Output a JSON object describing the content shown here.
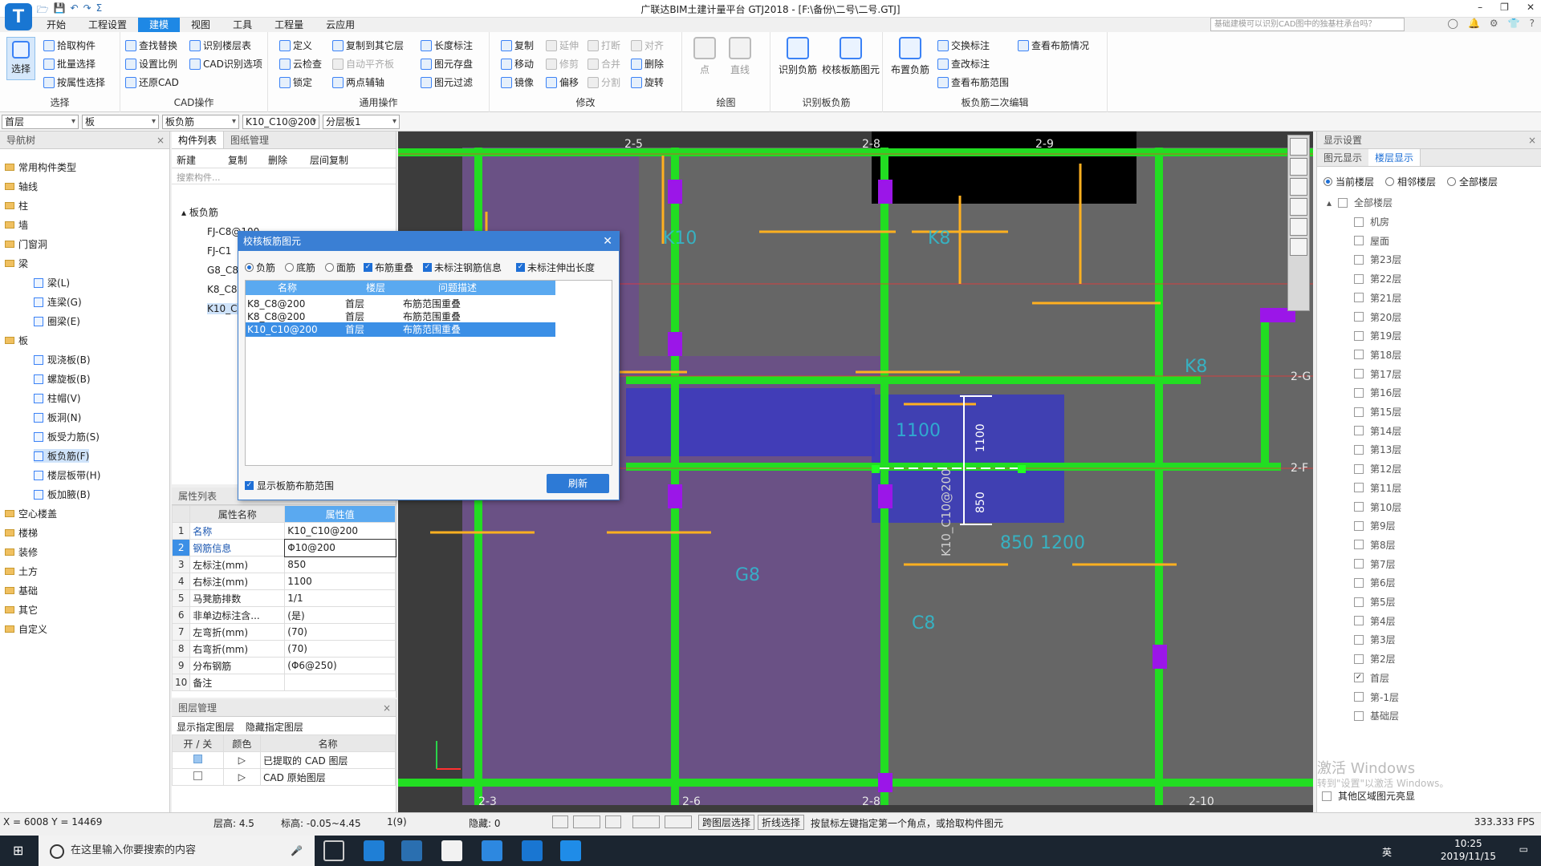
{
  "titlebar": {
    "title": "广联达BIM土建计量平台 GTJ2018 - [F:\\备份\\二号\\二号.GTJ]",
    "controls": [
      "–",
      "❐",
      "✕"
    ]
  },
  "menu": {
    "tabs": [
      "开始",
      "工程设置",
      "建模",
      "视图",
      "工具",
      "工程量",
      "云应用"
    ],
    "active": "建模",
    "search_placeholder": "基础建模可以识别CAD图中的独基柱承台吗？"
  },
  "ribbon": {
    "select": {
      "big": "选择",
      "items": [
        "拾取构件",
        "批量选择",
        "按属性选择"
      ],
      "label": "选择"
    },
    "cad": {
      "items": [
        "查找替换",
        "识别楼层表",
        "设置比例",
        "CAD识别选项",
        "还原CAD"
      ],
      "label": "CAD操作"
    },
    "general": {
      "items": [
        "定义",
        "复制到其它层",
        "长度标注",
        "云检查",
        "自动平齐板",
        "图元存盘",
        "锁定",
        "两点辅轴",
        "图元过滤"
      ],
      "label": "通用操作"
    },
    "modify": {
      "items": [
        "复制",
        "延伸",
        "打断",
        "对齐",
        "删除",
        "移动",
        "修剪",
        "合并",
        "镜像",
        "偏移",
        "分割",
        "旋转"
      ],
      "label": "修改"
    },
    "draw": {
      "items": [
        "点",
        "直线"
      ],
      "label": "绘图"
    },
    "recog": {
      "items": [
        "识别负筋",
        "校核板筋图元"
      ],
      "label": "识别板负筋"
    },
    "edit2": {
      "items": [
        "布置负筋",
        "交换标注",
        "查看布筋情况",
        "查改标注",
        "查看布筋范围"
      ],
      "label": "板负筋二次编辑"
    }
  },
  "filters": [
    "首层",
    "板",
    "板负筋",
    "K10_C10@200",
    "分层板1"
  ],
  "navtree": {
    "title": "导航树",
    "items": [
      {
        "label": "常用构件类型",
        "type": "folder"
      },
      {
        "label": "轴线",
        "type": "folder"
      },
      {
        "label": "柱",
        "type": "folder"
      },
      {
        "label": "墙",
        "type": "folder"
      },
      {
        "label": "门窗洞",
        "type": "folder"
      },
      {
        "label": "梁",
        "type": "folder"
      },
      {
        "label": "梁(L)",
        "type": "sub"
      },
      {
        "label": "连梁(G)",
        "type": "sub"
      },
      {
        "label": "圈梁(E)",
        "type": "sub"
      },
      {
        "label": "板",
        "type": "folder"
      },
      {
        "label": "现浇板(B)",
        "type": "sub"
      },
      {
        "label": "螺旋板(B)",
        "type": "sub"
      },
      {
        "label": "柱帽(V)",
        "type": "sub"
      },
      {
        "label": "板洞(N)",
        "type": "sub"
      },
      {
        "label": "板受力筋(S)",
        "type": "sub"
      },
      {
        "label": "板负筋(F)",
        "type": "sub",
        "selected": true
      },
      {
        "label": "楼层板带(H)",
        "type": "sub"
      },
      {
        "label": "板加腋(B)",
        "type": "sub"
      },
      {
        "label": "空心楼盖",
        "type": "folder"
      },
      {
        "label": "楼梯",
        "type": "folder"
      },
      {
        "label": "装修",
        "type": "folder"
      },
      {
        "label": "土方",
        "type": "folder"
      },
      {
        "label": "基础",
        "type": "folder"
      },
      {
        "label": "其它",
        "type": "folder"
      },
      {
        "label": "自定义",
        "type": "folder"
      }
    ]
  },
  "complist": {
    "tabs": [
      "构件列表",
      "图纸管理"
    ],
    "toolbar": [
      "新建",
      "复制",
      "删除",
      "层间复制"
    ],
    "search_placeholder": "搜索构件...",
    "root": "板负筋",
    "items": [
      "FJ-C8@100",
      "FJ-C1",
      "G8_C8",
      "K8_C8",
      "K10_C"
    ]
  },
  "props": {
    "title": "属性列表",
    "col_name": "属性名称",
    "col_value": "属性值",
    "rows": [
      {
        "n": "1",
        "k": "名称",
        "v": "K10_C10@200",
        "blue": true
      },
      {
        "n": "2",
        "k": "钢筋信息",
        "v": "Φ10@200",
        "blue": true
      },
      {
        "n": "3",
        "k": "左标注(mm)",
        "v": "850"
      },
      {
        "n": "4",
        "k": "右标注(mm)",
        "v": "1100"
      },
      {
        "n": "5",
        "k": "马凳筋排数",
        "v": "1/1"
      },
      {
        "n": "6",
        "k": "非单边标注含...",
        "v": "(是)"
      },
      {
        "n": "7",
        "k": "左弯折(mm)",
        "v": "(70)"
      },
      {
        "n": "8",
        "k": "右弯折(mm)",
        "v": "(70)"
      },
      {
        "n": "9",
        "k": "分布钢筋",
        "v": "(Φ6@250)"
      },
      {
        "n": "10",
        "k": "备注",
        "v": ""
      }
    ]
  },
  "layers": {
    "title": "图层管理",
    "links": [
      "显示指定图层",
      "隐藏指定图层"
    ],
    "cols": [
      "开 / 关",
      "颜色",
      "名称"
    ],
    "rows": [
      {
        "name": "已提取的 CAD 图层",
        "on": true
      },
      {
        "name": "CAD 原始图层",
        "on": false
      }
    ]
  },
  "dialog": {
    "title": "校核板筋图元",
    "options": [
      "负筋",
      "底筋",
      "面筋",
      "布筋重叠",
      "未标注钢筋信息",
      "未标注伸出长度"
    ],
    "cols": [
      "名称",
      "楼层",
      "问题描述"
    ],
    "rows": [
      {
        "name": "K8_C8@200",
        "floor": "首层",
        "desc": "布筋范围重叠"
      },
      {
        "name": "K8_C8@200",
        "floor": "首层",
        "desc": "布筋范围重叠"
      },
      {
        "name": "K10_C10@200",
        "floor": "首层",
        "desc": "布筋范围重叠",
        "selected": true
      }
    ],
    "show_range": "显示板筋布筋范围",
    "refresh": "刷新"
  },
  "canvas": {
    "axes": [
      "2-5",
      "2-8",
      "2-9",
      "2-3",
      "2-6",
      "2-8",
      "2-10",
      "2-G",
      "2-F"
    ],
    "rebar_label": "K10_C10@200",
    "dim1": "1100",
    "dim2": "850",
    "labels": [
      "K10",
      "K8",
      "K8",
      "850",
      "1100",
      "850",
      "1200",
      "G8",
      "C8"
    ]
  },
  "display": {
    "title": "显示设置",
    "tabs": [
      "图元显示",
      "楼层显示"
    ],
    "radios": [
      "当前楼层",
      "相邻楼层",
      "全部楼层"
    ],
    "all": "全部楼层",
    "floors": [
      "机房",
      "屋面",
      "第23层",
      "第22层",
      "第21层",
      "第20层",
      "第19层",
      "第18层",
      "第17层",
      "第16层",
      "第15层",
      "第14层",
      "第13层",
      "第12层",
      "第11层",
      "第10层",
      "第9层",
      "第8层",
      "第7层",
      "第6层",
      "第5层",
      "第4层",
      "第3层",
      "第2层",
      "首层",
      "第-1层",
      "基础层"
    ],
    "checked_floor": "首层",
    "other_region": "其他区域图元亮显",
    "watermark1": "激活 Windows",
    "watermark2": "转到\"设置\"以激活 Windows。"
  },
  "status": {
    "coords": "X = 6008 Y = 14469",
    "floor_h": "层高:  4.5",
    "elev": "标高:  -0.05~4.45",
    "count": "1(9)",
    "hidden": "隐藏:  0",
    "btn1": "跨图层选择",
    "btn2": "折线选择",
    "hint": "按鼠标左键指定第一个角点，或拾取构件图元",
    "fps": "333.333 FPS"
  },
  "taskbar": {
    "search": "在这里输入你要搜索的内容",
    "time": "10:25",
    "date": "2019/11/15",
    "ime": "英"
  }
}
